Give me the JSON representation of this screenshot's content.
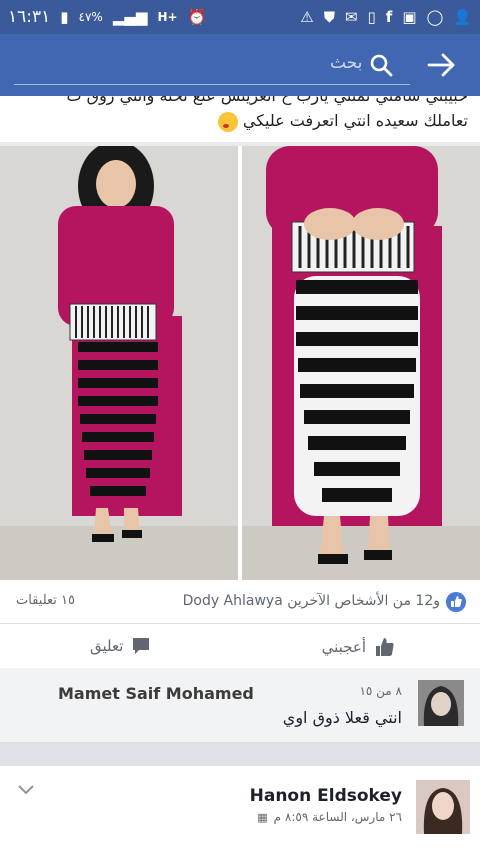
{
  "status_bar": {
    "time": "١٦:٣١",
    "battery_percent": "٤٧%",
    "network": "H+"
  },
  "app_bar": {
    "search_placeholder": "بحث"
  },
  "post": {
    "text_line1": "حبيبتي شامتي تمتتي يارب ح انعريتس عنع تحته وانتي روق ت",
    "text_line2": "تعاملك سعيده انتي اتعرفت عليكي",
    "reactions_text": "و12 من الأشخاص الآخرين Dody Ahlawya",
    "comments_count": "١٥ تعليقات",
    "like_label": "أعجبني",
    "comment_label": "تعليق"
  },
  "comment": {
    "author": "Mamet Saif Mohamed",
    "time": "٨ من ١٥",
    "text": "انتي قعلا ذوق اوي"
  },
  "next_post": {
    "author": "Hanon Eldsokey",
    "time": "٢٦ مارس، الساعة ٨:٥٩ م"
  },
  "colors": {
    "status_bar": "#3a5a9a",
    "app_bar": "#4267b2",
    "skirt_stripe_dark": "#111111",
    "top_magenta": "#b5155f"
  }
}
